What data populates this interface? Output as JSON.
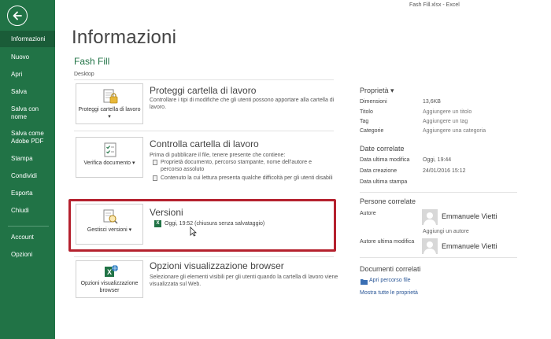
{
  "window": {
    "title": "Fash Fill.xlsx - Excel"
  },
  "sidebar": {
    "items": [
      {
        "label": "Informazioni"
      },
      {
        "label": "Nuovo"
      },
      {
        "label": "Apri"
      },
      {
        "label": "Salva"
      },
      {
        "label": "Salva con nome"
      },
      {
        "label": "Salva come Adobe PDF"
      },
      {
        "label": "Stampa"
      },
      {
        "label": "Condividi"
      },
      {
        "label": "Esporta"
      },
      {
        "label": "Chiudi"
      },
      {
        "label": "Account"
      },
      {
        "label": "Opzioni"
      }
    ]
  },
  "header": {
    "title": "Informazioni",
    "file_name": "Fash Fill",
    "file_location": "Desktop"
  },
  "sections": {
    "protect": {
      "tile_label": "Proteggi cartella di lavoro ▾",
      "title": "Proteggi cartella di lavoro",
      "description": "Controllare i tipi di modifiche che gli utenti possono apportare alla cartella di lavoro."
    },
    "inspect": {
      "tile_label": "Verifica documento ▾",
      "title": "Controlla cartella di lavoro",
      "description": "Prima di pubblicare il file, tenere presente che contiene:",
      "bullets": [
        "Proprietà documento, percorso stampante, nome dell'autore e percorso assoluto",
        "Contenuto la cui lettura presenta qualche difficoltà per gli utenti disabili"
      ]
    },
    "versions": {
      "tile_label": "Gestisci versioni ▾",
      "title": "Versioni",
      "entry": "Oggi, 19:52 (chiusura senza salvataggio)"
    },
    "browser": {
      "tile_label": "Opzioni visualizzazione browser",
      "title": "Opzioni visualizzazione browser",
      "description": "Selezionare gli elementi visibili per gli utenti quando la cartella di lavoro viene visualizzata sul Web."
    }
  },
  "properties": {
    "header": "Proprietà ▾",
    "rows": [
      {
        "label": "Dimensioni",
        "value": "13,6KB"
      },
      {
        "label": "Titolo",
        "value": "Aggiungere un titolo"
      },
      {
        "label": "Tag",
        "value": "Aggiungere un tag"
      },
      {
        "label": "Categorie",
        "value": "Aggiungere una categoria"
      }
    ]
  },
  "dates": {
    "header": "Date correlate",
    "rows": [
      {
        "label": "Data ultima modifica",
        "value": "Oggi, 19:44"
      },
      {
        "label": "Data creazione",
        "value": "24/01/2016 15:12"
      },
      {
        "label": "Data ultima stampa",
        "value": ""
      }
    ]
  },
  "people": {
    "header": "Persone correlate",
    "author_label": "Autore",
    "author_name": "Emmanuele Vietti",
    "add_author": "Aggiungi un autore",
    "last_modified_label": "Autore ultima modifica",
    "last_modified_name": "Emmanuele Vietti"
  },
  "documents": {
    "header": "Documenti correlati",
    "open_location": "Apri percorso file",
    "show_all": "Mostra tutte le proprietà"
  },
  "colors": {
    "sidebar": "#217346",
    "sidebar_active": "#1a5c38",
    "highlight": "#b5212e"
  }
}
